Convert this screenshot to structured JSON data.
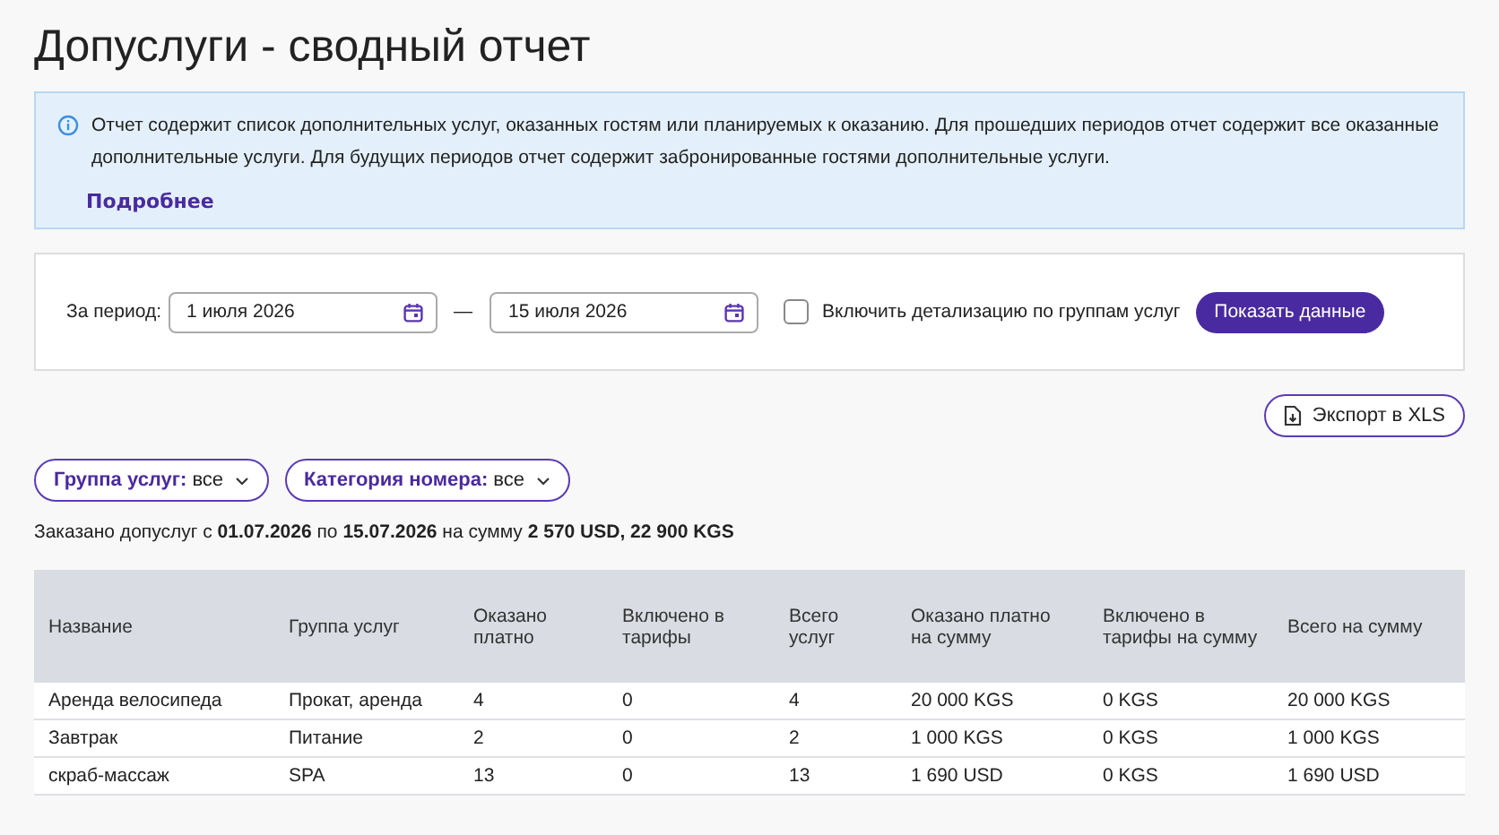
{
  "title": "Допуслуги - сводный отчет",
  "info": {
    "text": "Отчет содержит список дополнительных услуг, оказанных гостям или планируемых к оказанию. Для прошедших периодов отчет содержит все оказанные дополнительные услуги. Для будущих периодов отчет содержит забронированные гостями дополнительные услуги.",
    "link": "Подробнее"
  },
  "filter": {
    "label": "За период:",
    "date_from": "1 июля 2026",
    "separator": "—",
    "date_to": "15 июля 2026",
    "detail_checkbox": {
      "label": "Включить детализацию по группам услуг",
      "checked": false
    },
    "submit": "Показать данные"
  },
  "export_button": "Экспорт в XLS",
  "chips": [
    {
      "label": "Группа услуг:",
      "value": "все"
    },
    {
      "label": "Категория номера:",
      "value": "все"
    }
  ],
  "summary": "Заказано допуслуг с **01.07.2026** по **15.07.2026** на сумму **2 570 USD, 22 900 KGS**",
  "table": {
    "columns": [
      "Название",
      "Группа услуг",
      "Оказано платно",
      "Включено в тарифы",
      "Всего услуг",
      "Оказано платно на сумму",
      "Включено в тарифы на сумму",
      "Всего на сумму"
    ],
    "rows": [
      [
        "Аренда велосипеда",
        "Прокат, аренда",
        "4",
        "0",
        "4",
        "20 000 KGS",
        "0 KGS",
        "20 000 KGS"
      ],
      [
        "Завтрак",
        "Питание",
        "2",
        "0",
        "2",
        "1 000 KGS",
        "0 KGS",
        "1 000 KGS"
      ],
      [
        "скраб-массаж",
        "SPA",
        "13",
        "0",
        "13",
        "1 690 USD",
        "0 KGS",
        "1 690 USD"
      ]
    ]
  }
}
